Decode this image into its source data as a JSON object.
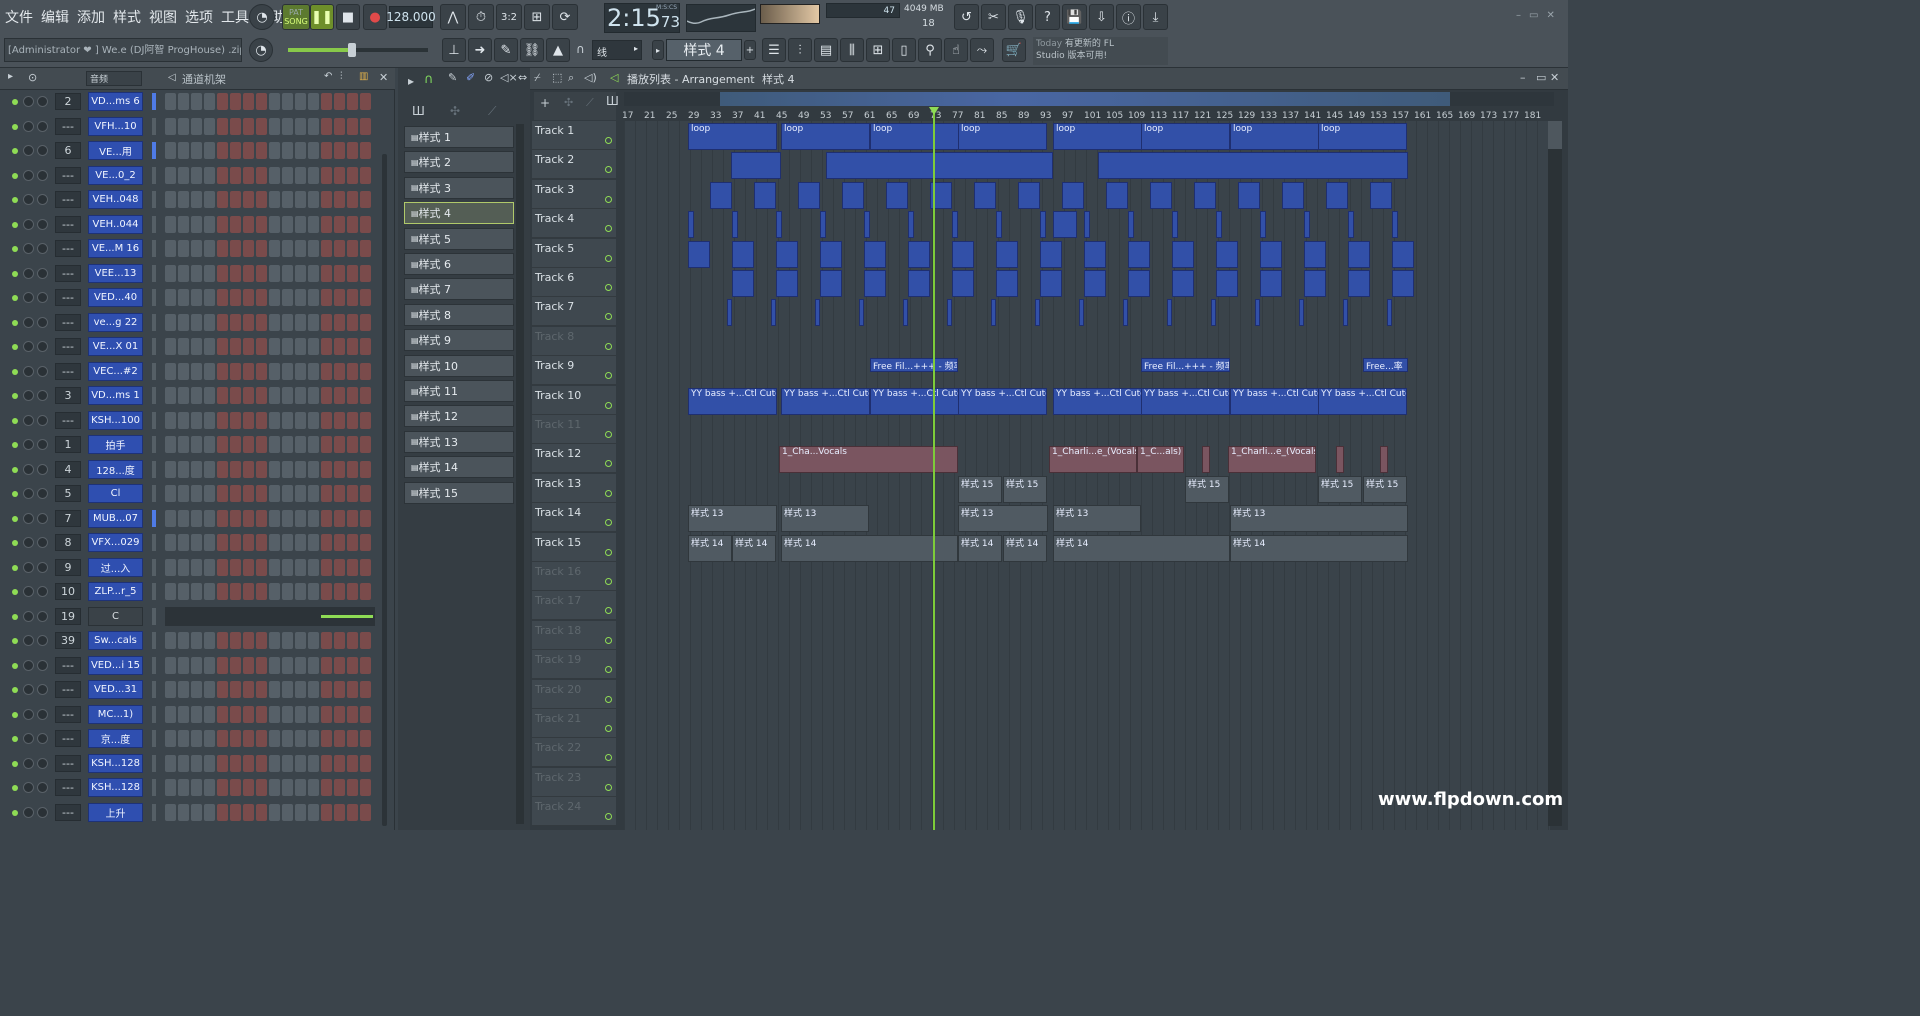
{
  "menu": [
    "文件",
    "编辑",
    "添加",
    "样式",
    "视图",
    "选项",
    "工具",
    "帮助"
  ],
  "transport": {
    "song_label": "SONG",
    "pat_label": "PAT",
    "tempo": "128.000",
    "time": "2:15",
    "time_frac": "73",
    "time_unit": "M:S:CS",
    "cpu": "47",
    "mem": "4049 MB",
    "poly": "18"
  },
  "project": {
    "user": "[Administrator ❤",
    "file": "] We.e (DJ阿智 ProgHouse) .zip"
  },
  "toolbar": {
    "snap": "线",
    "pattern_selector": "样式 4"
  },
  "news": {
    "today": "Today",
    "line1": "有更新的 FL",
    "line2": "Studio 版本可用!"
  },
  "channel_rack": {
    "filter": "音频",
    "title": "通道机架",
    "channels": [
      {
        "num": "2",
        "name": "VD...ms 6"
      },
      {
        "num": "---",
        "name": "VFH...10"
      },
      {
        "num": "6",
        "name": "VE...用"
      },
      {
        "num": "---",
        "name": "VE...0_2"
      },
      {
        "num": "---",
        "name": "VEH..048"
      },
      {
        "num": "---",
        "name": "VEH..044"
      },
      {
        "num": "---",
        "name": "VE...M 16"
      },
      {
        "num": "---",
        "name": "VEE...13"
      },
      {
        "num": "---",
        "name": "VED...40"
      },
      {
        "num": "---",
        "name": "ve...g 22"
      },
      {
        "num": "---",
        "name": "VE...X 01"
      },
      {
        "num": "---",
        "name": "VEC...#2"
      },
      {
        "num": "3",
        "name": "VD...ms 1"
      },
      {
        "num": "---",
        "name": "KSH...100"
      },
      {
        "num": "1",
        "name": "拍手"
      },
      {
        "num": "4",
        "name": "128...度"
      },
      {
        "num": "5",
        "name": "Cl"
      },
      {
        "num": "7",
        "name": "MUB...07"
      },
      {
        "num": "8",
        "name": "VFX...029"
      },
      {
        "num": "9",
        "name": "过...入"
      },
      {
        "num": "10",
        "name": "ZLP...r_5"
      },
      {
        "num": "19",
        "name": "C"
      },
      {
        "num": "39",
        "name": "Sw...cals"
      },
      {
        "num": "---",
        "name": "VED...i 15"
      },
      {
        "num": "---",
        "name": "VED...31"
      },
      {
        "num": "---",
        "name": "MC...1)"
      },
      {
        "num": "---",
        "name": "京...度"
      },
      {
        "num": "---",
        "name": "KSH...128"
      },
      {
        "num": "---",
        "name": "KSH...128"
      },
      {
        "num": "---",
        "name": "上升"
      }
    ]
  },
  "patterns": [
    "样式 1",
    "样式 2",
    "样式 3",
    "样式 4",
    "样式 5",
    "样式 6",
    "样式 7",
    "样式 8",
    "样式 9",
    "样式 10",
    "样式 11",
    "样式 12",
    "样式 13",
    "样式 14",
    "样式 15"
  ],
  "playlist": {
    "title": "播放列表 - Arrangement",
    "pattern": "样式 4",
    "ruler": [
      "17",
      "21",
      "25",
      "29",
      "33",
      "37",
      "41",
      "45",
      "49",
      "53",
      "57",
      "61",
      "65",
      "69",
      "73",
      "77",
      "81",
      "85",
      "89",
      "93",
      "97",
      "101",
      "105",
      "109",
      "113",
      "117",
      "121",
      "125",
      "129",
      "133",
      "137",
      "141",
      "145",
      "149",
      "153",
      "157",
      "161",
      "165",
      "169",
      "173",
      "177",
      "181"
    ],
    "tracks": [
      "Track 1",
      "Track 2",
      "Track 3",
      "Track 4",
      "Track 5",
      "Track 6",
      "Track 7",
      "Track 8",
      "Track 9",
      "Track 10",
      "Track 11",
      "Track 12",
      "Track 13",
      "Track 14",
      "Track 15",
      "Track 16",
      "Track 17",
      "Track 18",
      "Track 19",
      "Track 20",
      "Track 21",
      "Track 22",
      "Track 23",
      "Track 24"
    ],
    "clip_labels": {
      "loop": "loop",
      "free_filter": "Free Fil...+++ - 频率",
      "free_short": "Free...率",
      "yy_bass": "YY bass +...Ctl Cutoff",
      "vocals_a": "1_Cha...Vocals",
      "vocals_b": "1_Charli...e_(Vocals)",
      "vocals_c": "1_C...als)",
      "pat13": "样式 13",
      "pat14": "样式 14",
      "pat15": "样式 15"
    }
  },
  "watermark": "www.flpdown.com"
}
